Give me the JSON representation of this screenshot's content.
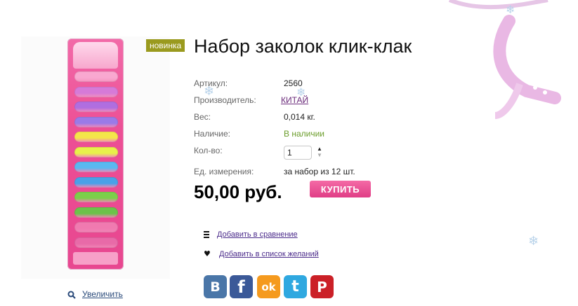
{
  "product": {
    "title": "Набор заколок клик-клак",
    "badge": "новинка",
    "zoom_label": "Увеличить",
    "specs": [
      {
        "label": "Артикул:",
        "value": "2560"
      },
      {
        "label": "Производитель:",
        "value": "КИТАЙ"
      },
      {
        "label": "Вес:",
        "value": "0,014 кг."
      },
      {
        "label": "Наличие:",
        "value": "В наличии"
      },
      {
        "label": "Кол-во:",
        "value": "1"
      },
      {
        "label": "Ед. измерения:",
        "value": "за набор из 12 шт."
      }
    ],
    "price": "50,00 руб.",
    "buy_label": "КУПИТЬ"
  },
  "actions": {
    "compare_label": "Добавить в сравнение",
    "wishlist_label": "Добавить в список желаний"
  },
  "social": [
    {
      "icon": "vk-icon",
      "glyph": "B",
      "color": "#4a76a8"
    },
    {
      "icon": "facebook-icon",
      "glyph": "f",
      "color": "#3b5998"
    },
    {
      "icon": "odnoklassniki-icon",
      "glyph": "ok",
      "color": "#f59a1e"
    },
    {
      "icon": "twitter-icon",
      "glyph": "t",
      "color": "#2fa8e0"
    },
    {
      "icon": "pinterest-icon",
      "glyph": "P",
      "color": "#cb2027"
    }
  ],
  "colors": {
    "accent": "#e84790",
    "badge": "#9a9a1e",
    "in_stock": "#6a9c2a"
  }
}
